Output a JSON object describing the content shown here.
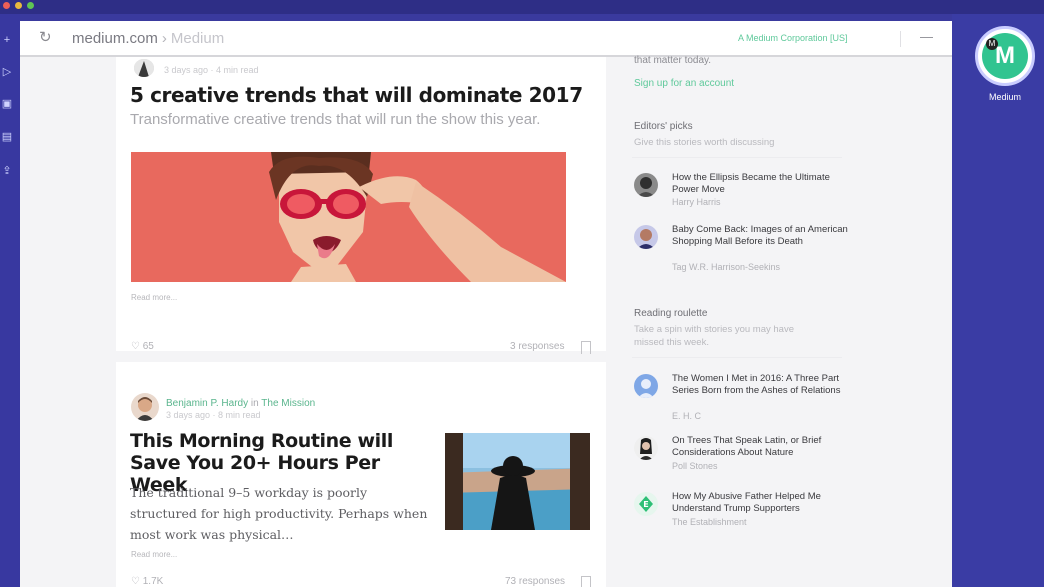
{
  "window_controls": {
    "close": "close",
    "minimize": "minimize",
    "maximize": "maximize"
  },
  "browser": {
    "url": "medium.com",
    "site_name": "Medium",
    "cert_label": "A Medium Corporation [US]"
  },
  "feed": {
    "posts": [
      {
        "meta": "3 days ago · 4 min read",
        "title": "5 creative trends that will dominate 2017",
        "subtitle": "Transformative creative trends that will run the show this year.",
        "read_more": "Read more...",
        "claps": "65",
        "responses": "3 responses"
      },
      {
        "author": "Benjamin P. Hardy",
        "in_word": "in",
        "publication": "The Mission",
        "meta": "3 days ago · 8 min read",
        "title": "This Morning Routine will Save You 20+ Hours Per Week",
        "body": "The traditional 9–5 workday is poorly structured for high productivity. Perhaps when most work was physical…",
        "read_more": "Read more...",
        "claps": "1.7K",
        "responses": "73 responses"
      }
    ]
  },
  "sidebar": {
    "intro_text": "that matter today.",
    "signup_link": "Sign up for an account",
    "editors_picks": {
      "heading": "Editors' picks",
      "description": "Give this stories worth discussing",
      "items": [
        {
          "title": "How the Ellipsis Became the Ultimate Power Move",
          "author": "Harry Harris"
        },
        {
          "title": "Baby Come Back: Images of an American Shopping Mall Before its Death",
          "author": "Tag W.R. Harrison-Seekins"
        }
      ]
    },
    "reading_roulette": {
      "heading": "Reading roulette",
      "description": "Take a spin with stories you may have missed this week.",
      "items": [
        {
          "title": "The Women I Met in 2016: A Three Part Series Born from the Ashes of Relations",
          "author": "E. H. C"
        },
        {
          "title": "On Trees That Speak Latin, or Brief Considerations About Nature",
          "author": "Poll Stones"
        },
        {
          "title": "How My Abusive Father Helped Me Understand Trump Supporters",
          "author": "The Establishment"
        }
      ]
    }
  },
  "app": {
    "name": "Medium",
    "badge_letter": "M",
    "mini_letter": "M"
  }
}
